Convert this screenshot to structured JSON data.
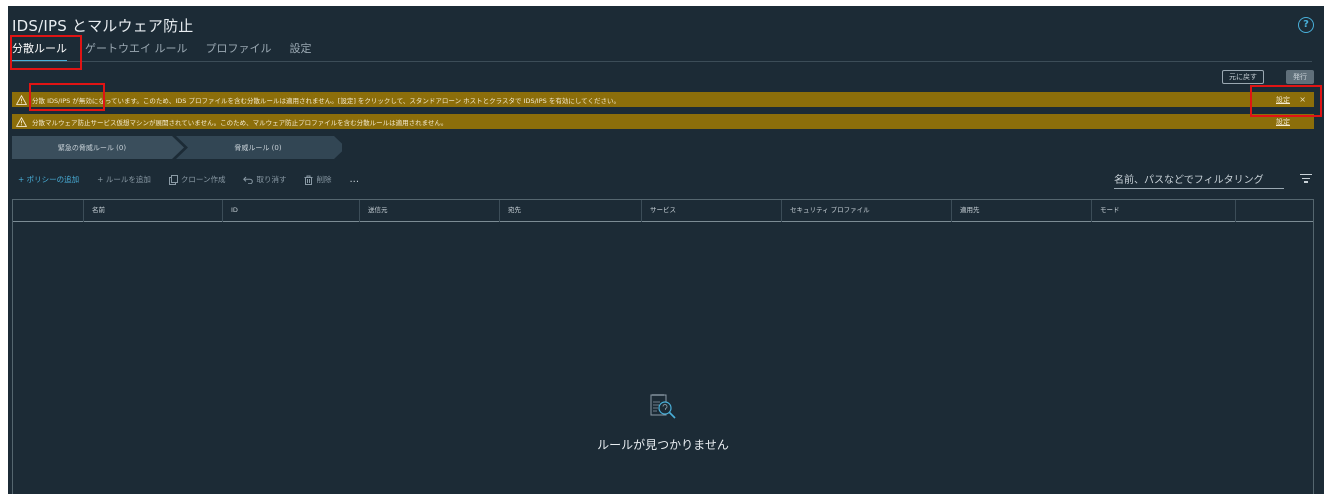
{
  "page": {
    "title": "IDS/IPS とマルウェア防止",
    "help_icon": "?"
  },
  "tabs": [
    {
      "label": "分散ルール",
      "active": true
    },
    {
      "label": "ゲートウエイ ルール",
      "active": false
    },
    {
      "label": "プロファイル",
      "active": false
    },
    {
      "label": "設定",
      "active": false
    }
  ],
  "actions": {
    "revert": "元に戻す",
    "publish": "発行"
  },
  "alerts": [
    {
      "text": "分散 IDS/IPS が無効になっています。このため、IDS プロファイルを含む分散ルールは適用されません。[設定] をクリックして、スタンドアローン ホストとクラスタで IDS/IPS を有効にしてください。",
      "link": "設定",
      "close": "×"
    },
    {
      "text": "分散マルウェア防止サービス仮想マシンが展開されていません。このため、マルウェア防止プロファイルを含む分散ルールは適用されません。",
      "link": "設定"
    }
  ],
  "categories": [
    {
      "label": "緊急の脅威ルール (0)"
    },
    {
      "label": "脅威ルール (0)"
    }
  ],
  "toolbar": {
    "add_policy": "+ ポリシーの追加",
    "add_rule": "+ ルールを追加",
    "clone": "クローン作成",
    "undo": "取り消す",
    "delete": "削除",
    "more": "..."
  },
  "filter": {
    "placeholder": "名前、パスなどでフィルタリング"
  },
  "table": {
    "columns": [
      "名前",
      "ID",
      "送信元",
      "宛先",
      "サービス",
      "セキュリティ プロファイル",
      "適用先",
      "モード"
    ]
  },
  "empty_state": {
    "message": "ルールが見つかりません"
  },
  "colors": {
    "background": "#1c2b36",
    "accent": "#49afd9",
    "warning": "#8c6e0a",
    "highlight": "#e01414"
  }
}
